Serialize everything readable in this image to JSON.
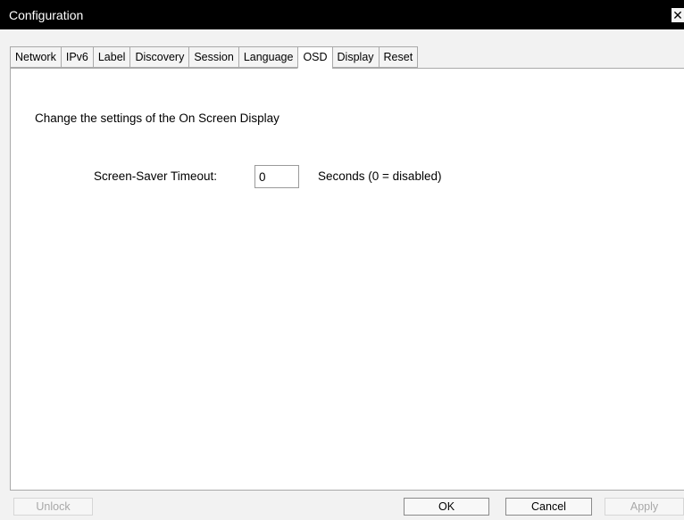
{
  "window": {
    "title": "Configuration",
    "close_glyph": "✕"
  },
  "tabs": [
    {
      "label": "Network"
    },
    {
      "label": "IPv6"
    },
    {
      "label": "Label"
    },
    {
      "label": "Discovery"
    },
    {
      "label": "Session"
    },
    {
      "label": "Language"
    },
    {
      "label": "OSD",
      "active": true
    },
    {
      "label": "Display"
    },
    {
      "label": "Reset"
    }
  ],
  "osd": {
    "description": "Change the settings of the On Screen Display",
    "timeout_label": "Screen-Saver Timeout:",
    "timeout_value": "0",
    "timeout_hint": "Seconds (0 = disabled)"
  },
  "buttons": {
    "unlock": "Unlock",
    "ok": "OK",
    "cancel": "Cancel",
    "apply": "Apply"
  }
}
